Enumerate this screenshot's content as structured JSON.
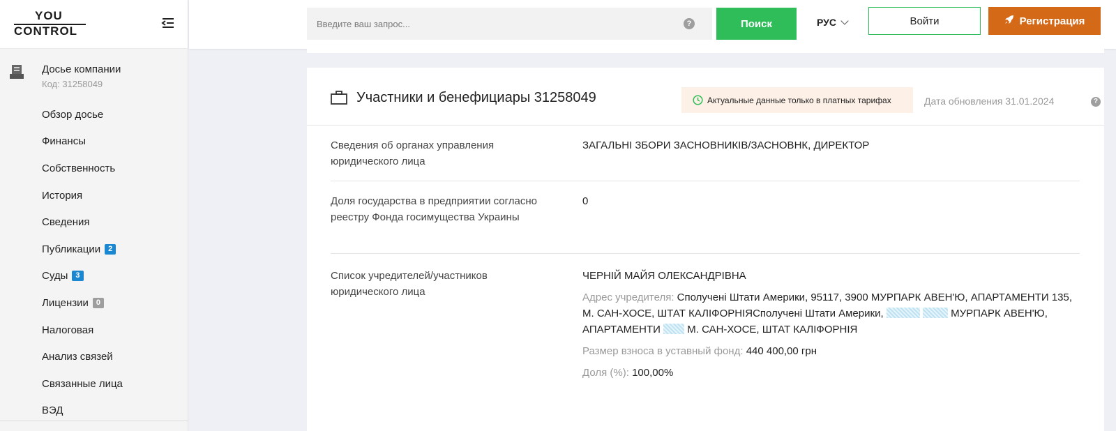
{
  "logo": {
    "line1": "YOU",
    "line2": "CONTROL"
  },
  "sidebar": {
    "dossier_title": "Досье компании",
    "dossier_code": "Код: 31258049",
    "items": [
      {
        "label": "Обзор досье"
      },
      {
        "label": "Финансы"
      },
      {
        "label": "Собственность"
      },
      {
        "label": "История"
      },
      {
        "label": "Сведения"
      },
      {
        "label": "Публикации",
        "badge": "2"
      },
      {
        "label": "Суды",
        "badge": "3"
      },
      {
        "label": "Лицензии",
        "badge": "0"
      },
      {
        "label": "Налоговая"
      },
      {
        "label": "Анализ связей"
      },
      {
        "label": "Связанные лица"
      },
      {
        "label": "ВЭД"
      }
    ]
  },
  "header": {
    "search_placeholder": "Введите ваш запрос...",
    "search_help": "?",
    "search_button": "Поиск",
    "language": "РУС",
    "login_button": "Войти",
    "register_button": "Регистрация"
  },
  "card": {
    "title": "Участники и бенефициары 31258049",
    "notice": "Актуальные данные только в платных тарифах",
    "update_date": "Дата обновления 31.01.2024",
    "update_help": "?",
    "rows": [
      {
        "label": "Сведения об органах управления юридического лица",
        "value": "ЗАГАЛЬНІ ЗБОРИ ЗАСНОВНИКІВ/ЗАСНОВНК, ДИРЕКТОР"
      },
      {
        "label": "Доля государства в предприятии согласно реестру Фонда госимущества Украины",
        "value": "0"
      },
      {
        "label": "Список учредителей/участников юридического лица",
        "founder_name": "ЧЕРНІЙ МАЙЯ ОЛЕКСАНДРІВНА",
        "address_label": "Адрес учредителя:",
        "address_part1": "Сполучені Штати Америки, 95117, 3900 МУРПАРК АВЕН'Ю, АПАРТАМЕНТИ 135, М. САН-ХОСЕ, ШТАТ КАЛІФОРНІЯСполучені Штати Америки,",
        "address_part2": "МУРПАРК АВЕН'Ю, АПАРТАМЕНТИ",
        "address_part3": "М. САН-ХОСЕ, ШТАТ КАЛІФОРНІЯ",
        "contribution_label": "Размер взноса в уставный фонд:",
        "contribution_value": "440 400,00 грн",
        "share_label": "Доля (%):",
        "share_value": "100,00%"
      }
    ]
  },
  "colors": {
    "accent_green": "#2ebd59",
    "register_orange": "#d46a17",
    "badge_blue": "#1a87d0",
    "notice_bg": "#fdf0e7"
  }
}
